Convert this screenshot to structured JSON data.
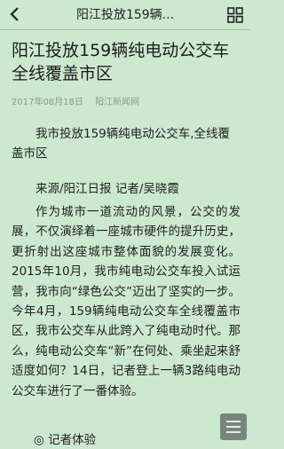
{
  "header": {
    "title": "阳江投放159辆..."
  },
  "article": {
    "title": "阳江投放159辆纯电动公交车全线覆盖市区",
    "date": "2017年08月18日",
    "source": "阳江新闻网",
    "lead": "我市投放159辆纯电动公交车,全线覆盖市区",
    "byline": "来源/阳江日报 记者/吴晓霞",
    "body": "作为城市一道流动的风景，公交的发展，不仅演绎着一座城市硬件的提升历史，更折射出这座城市整体面貌的发展变化。2015年10月，我市纯电动公交车投入试运营，我市向“绿色公交”迈出了坚实的一步。今年4月，159辆纯电动公交车全线覆盖市区，我市公交车从此跨入了纯电动时代。那么，纯电动公交车“新”在何处、乘坐起来舒适度如何？14日，记者登上一辆3路纯电动公交车进行了一番体验。",
    "section_heading": "◎ 记者体验"
  },
  "colors": {
    "background": "#cce8cf",
    "text": "#222222",
    "meta": "#8a9b8c",
    "fab": "#6f7c72"
  },
  "icons": {
    "back": "chevron-left-icon",
    "grid": "grid-icon",
    "menu": "menu-icon"
  }
}
